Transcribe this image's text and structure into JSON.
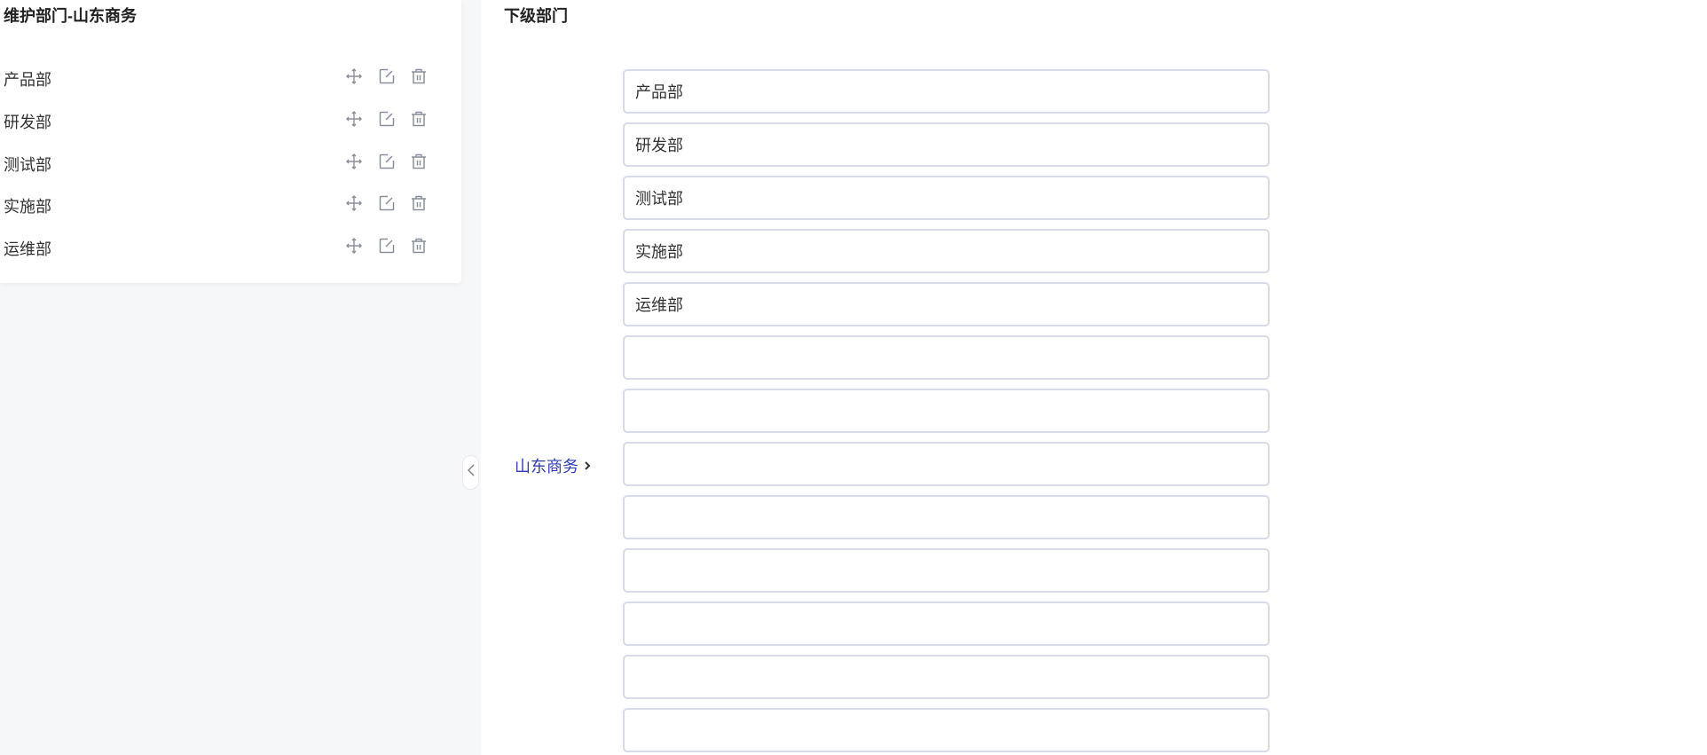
{
  "left_panel": {
    "title": "维护部门-山东商务",
    "items": [
      {
        "label": "产品部"
      },
      {
        "label": "研发部"
      },
      {
        "label": "测试部"
      },
      {
        "label": "实施部"
      },
      {
        "label": "运维部"
      }
    ],
    "item_icons": [
      "move-icon",
      "edit-icon",
      "delete-icon"
    ]
  },
  "right_panel": {
    "title": "下级部门",
    "parent_label": "山东商务",
    "inputs": [
      "产品部",
      "研发部",
      "测试部",
      "实施部",
      "运维部",
      "",
      "",
      "",
      "",
      "",
      "",
      "",
      ""
    ]
  },
  "colors": {
    "link": "#2f3fae",
    "icon": "#8a8f99",
    "input_border": "#d8dbe6"
  }
}
